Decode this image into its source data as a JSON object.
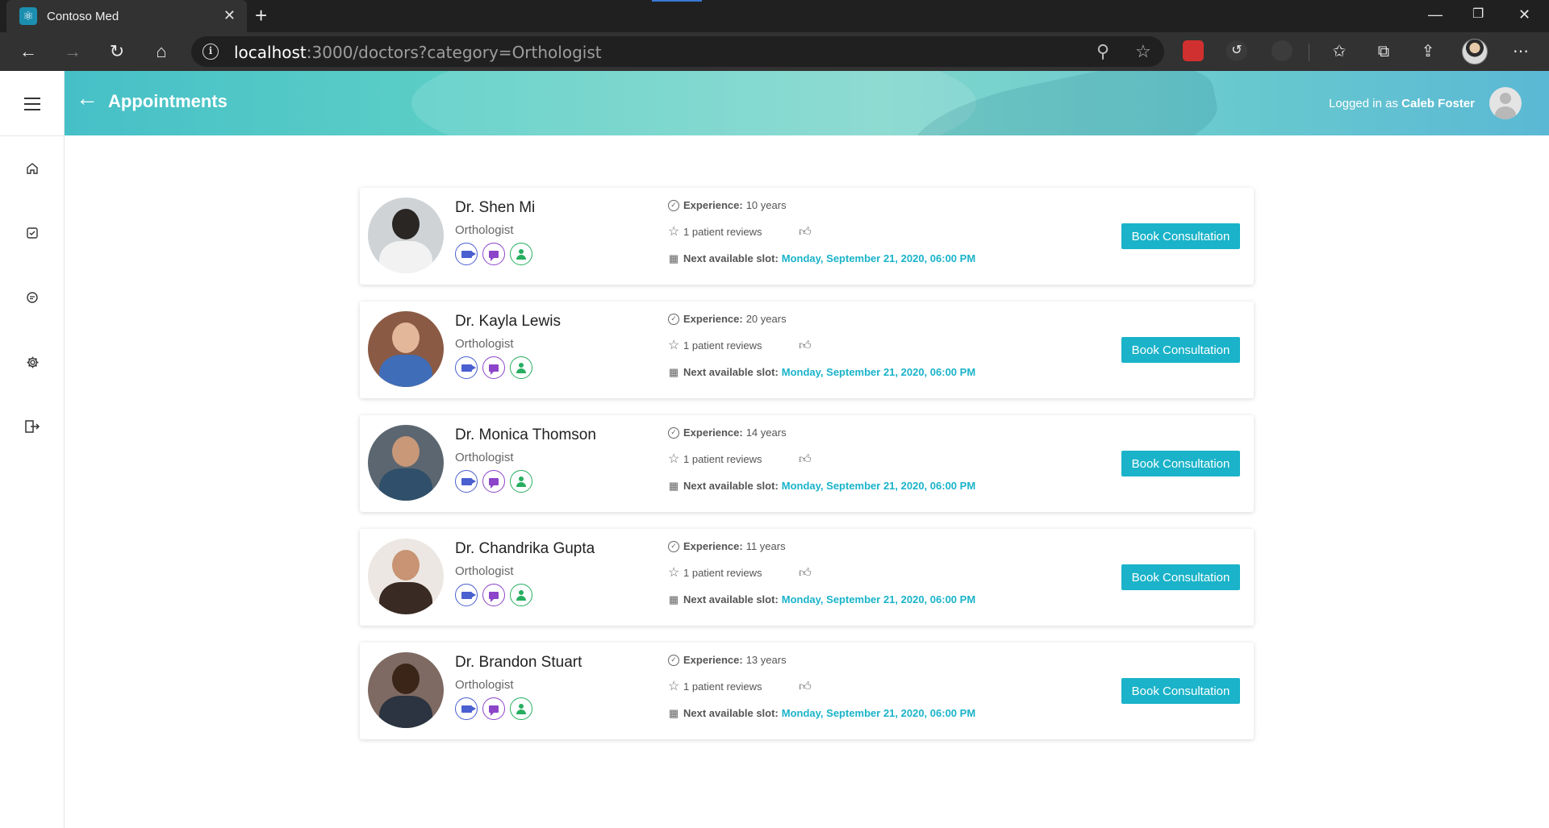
{
  "browser": {
    "tab_title": "Contoso Med",
    "url_host": "localhost",
    "url_rest": ":3000/doctors?category=Orthologist"
  },
  "header": {
    "title": "Appointments",
    "logged_in_prefix": "Logged in as",
    "user_name": "Caleb Foster"
  },
  "sidebar": {
    "items": [
      "home-icon",
      "checkbox-icon",
      "chat-icon",
      "gear-icon",
      "logout-icon"
    ]
  },
  "labels": {
    "experience": "Experience:",
    "reviews": "1 patient reviews",
    "next_slot": "Next available slot:",
    "book": "Book Consultation"
  },
  "doctors": [
    {
      "name": "Dr. Shen Mi",
      "specialty": "Orthologist",
      "experience": "10 years",
      "slot": "Monday, September 21, 2020, 06:00 PM"
    },
    {
      "name": "Dr. Kayla Lewis",
      "specialty": "Orthologist",
      "experience": "20 years",
      "slot": "Monday, September 21, 2020, 06:00 PM"
    },
    {
      "name": "Dr. Monica Thomson",
      "specialty": "Orthologist",
      "experience": "14 years",
      "slot": "Monday, September 21, 2020, 06:00 PM"
    },
    {
      "name": "Dr. Chandrika Gupta",
      "specialty": "Orthologist",
      "experience": "11 years",
      "slot": "Monday, September 21, 2020, 06:00 PM"
    },
    {
      "name": "Dr. Brandon Stuart",
      "specialty": "Orthologist",
      "experience": "13 years",
      "slot": "Monday, September 21, 2020, 06:00 PM"
    }
  ],
  "colors": {
    "accent": "#1ab3c9",
    "header_gradient_start": "#46c0c7",
    "video": "#4a5fd0",
    "chat": "#8c44c9",
    "in_person": "#27ae60"
  }
}
